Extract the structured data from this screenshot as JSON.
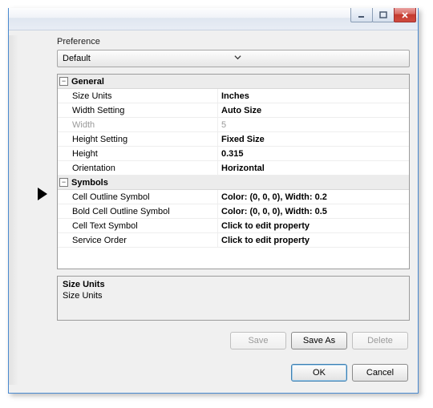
{
  "preference": {
    "label": "Preference",
    "selected": "Default"
  },
  "groups": [
    {
      "name": "General",
      "rows": [
        {
          "name": "Size Units",
          "value": "Inches",
          "disabled": false
        },
        {
          "name": "Width Setting",
          "value": "Auto Size",
          "disabled": false
        },
        {
          "name": "Width",
          "value": "5",
          "disabled": true
        },
        {
          "name": "Height Setting",
          "value": "Fixed Size",
          "disabled": false
        },
        {
          "name": "Height",
          "value": "0.315",
          "disabled": false
        },
        {
          "name": "Orientation",
          "value": "Horizontal",
          "disabled": false
        }
      ]
    },
    {
      "name": "Symbols",
      "rows": [
        {
          "name": "Cell Outline Symbol",
          "value": "Color: (0, 0, 0), Width: 0.2",
          "disabled": false
        },
        {
          "name": "Bold Cell Outline Symbol",
          "value": "Color: (0, 0, 0), Width: 0.5",
          "disabled": false
        },
        {
          "name": "Cell Text Symbol",
          "value": "Click to edit property",
          "disabled": false
        },
        {
          "name": "Service Order",
          "value": "Click to edit property",
          "disabled": false
        }
      ]
    }
  ],
  "description": {
    "title": "Size Units",
    "body": "Size Units"
  },
  "buttons": {
    "save": "Save",
    "save_as": "Save As",
    "delete": "Delete",
    "ok": "OK",
    "cancel": "Cancel"
  }
}
